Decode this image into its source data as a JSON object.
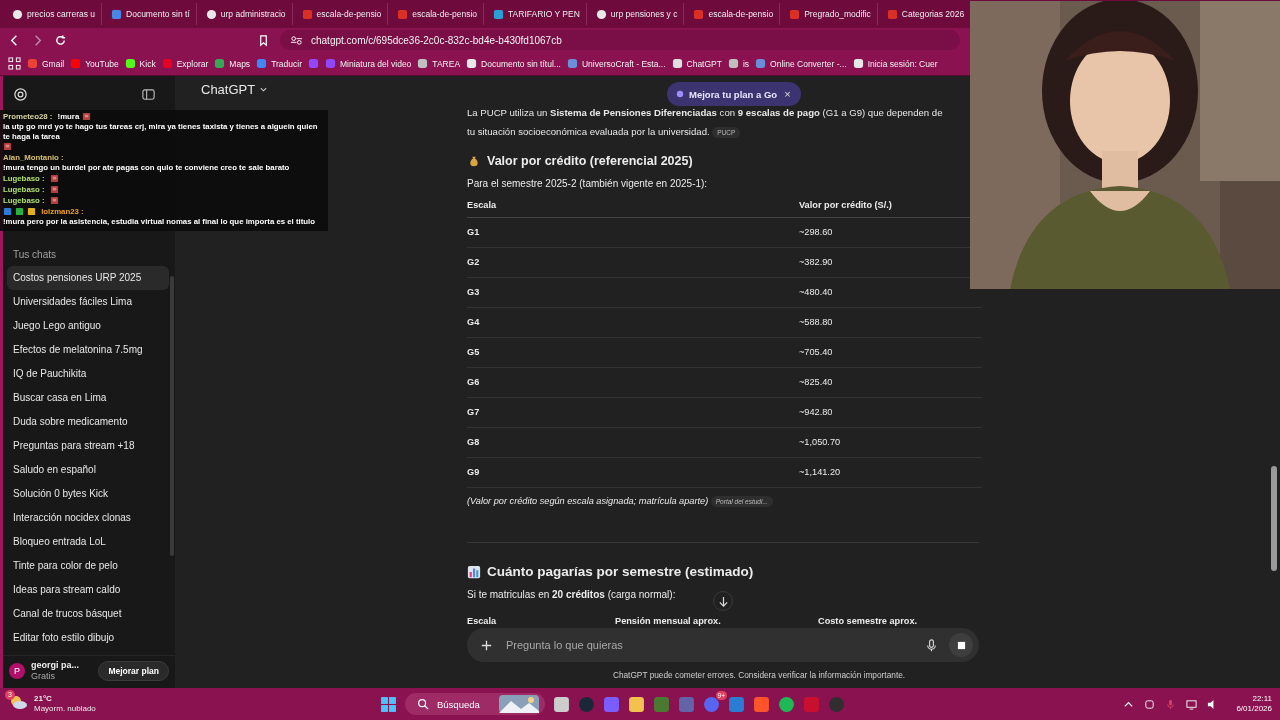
{
  "browser": {
    "tabs": [
      {
        "title": "precios carreras u",
        "kind": "google"
      },
      {
        "title": "Documento sin tí",
        "kind": "doc"
      },
      {
        "title": "urp administracio",
        "kind": "google"
      },
      {
        "title": "escala-de-pensio",
        "kind": "pdf"
      },
      {
        "title": "escala-de-pensio",
        "kind": "pdf"
      },
      {
        "title": "TARIFARIO Y PEN",
        "kind": "letter"
      },
      {
        "title": "urp pensiones y c",
        "kind": "google"
      },
      {
        "title": "escala-de-pensio",
        "kind": "pdf"
      },
      {
        "title": "Pregrado_modific",
        "kind": "pdf"
      },
      {
        "title": "Categorias 2026",
        "kind": "pdf"
      }
    ],
    "url": "chatgpt.com/c/695dce36-2c0c-832c-bd4e-b430fd1067cb",
    "bookmarks": [
      {
        "label": "Gmail",
        "kind": "mail"
      },
      {
        "label": "YouTube",
        "kind": "play"
      },
      {
        "label": "Kick",
        "kind": "kick"
      },
      {
        "label": "Explorar",
        "kind": "pin"
      },
      {
        "label": "Maps",
        "kind": "map"
      },
      {
        "label": "Traducir",
        "kind": "translate"
      },
      {
        "kind": "twitch"
      },
      {
        "label": "Miniatura del video",
        "kind": "twitch"
      },
      {
        "label": "TAREA",
        "kind": "shield"
      },
      {
        "label": "Documento sin títul...",
        "kind": "google"
      },
      {
        "label": "UniversoCraft - Esta...",
        "kind": "globe"
      },
      {
        "label": "ChatGPT",
        "kind": "knot"
      },
      {
        "label": "is",
        "kind": "shield"
      },
      {
        "label": "Online Converter -...",
        "kind": "globe"
      },
      {
        "label": "Inicia sesión: Cuer",
        "kind": "google"
      }
    ]
  },
  "chat_overlay": {
    "messages": [
      {
        "user": "Prometeo28 :",
        "color": "#d8d8a0",
        "segments": [
          {
            "kind": "text",
            "text": "!mura"
          },
          {
            "kind": "emote"
          },
          {
            "kind": "text",
            "text": "la utp go mrd yo te hago tus tareas crj, mira ya tienes taxista y tienes a alguein quien te haga la tarea"
          },
          {
            "kind": "emote"
          }
        ]
      },
      {
        "user": "Alan_Montanio :",
        "color": "#d8c070",
        "segments": [
          {
            "kind": "text",
            "text": "!mura tengo un burdel por ate pagas con qulo te conviene creo te sale barato"
          }
        ]
      },
      {
        "user": "Lugebaso :",
        "color": "#b0e070",
        "segments": [
          {
            "kind": "emote"
          }
        ]
      },
      {
        "user": "Lugebaso :",
        "color": "#b0e070",
        "segments": [
          {
            "kind": "emote"
          }
        ]
      },
      {
        "user": "Lugebaso :",
        "color": "#b0e070",
        "segments": [
          {
            "kind": "emote"
          }
        ]
      },
      {
        "user": "lolzman23 :",
        "color": "#f0a020",
        "segments": [
          {
            "kind": "badge"
          },
          {
            "kind": "badge"
          },
          {
            "kind": "badge"
          },
          {
            "kind": "text",
            "text": "!mura pero por la asistencia, estudia virtual nomas al final lo que importa es el titulo"
          }
        ]
      }
    ]
  },
  "sidebar": {
    "section": "Tus chats",
    "chats": [
      {
        "title": "Costos pensiones URP 2025",
        "selected": true
      },
      {
        "title": "Universidades fáciles Lima",
        "selected": false
      },
      {
        "title": "Juego Lego antiguo",
        "selected": false
      },
      {
        "title": "Efectos de melatonina 7.5mg",
        "selected": false
      },
      {
        "title": "IQ de Pauchikita",
        "selected": false
      },
      {
        "title": "Buscar casa en Lima",
        "selected": false
      },
      {
        "title": "Duda sobre medicamento",
        "selected": false
      },
      {
        "title": "Preguntas para stream +18",
        "selected": false
      },
      {
        "title": "Saludo en español",
        "selected": false
      },
      {
        "title": "Solución 0 bytes Kick",
        "selected": false
      },
      {
        "title": "Interacción nocidex clonas",
        "selected": false
      },
      {
        "title": "Bloqueo entrada LoL",
        "selected": false
      },
      {
        "title": "Tinte para color de pelo",
        "selected": false
      },
      {
        "title": "Ideas para stream caldo",
        "selected": false
      },
      {
        "title": "Canal de trucos básquet",
        "selected": false
      },
      {
        "title": "Editar foto estilo dibujo",
        "selected": false
      }
    ],
    "user": {
      "initial": "P",
      "name": "georgi pa...",
      "plan": "Gratis"
    },
    "upgrade_button": "Mejorar plan"
  },
  "header": {
    "title": "ChatGPT",
    "promo": "Mejora tu plan a Go",
    "promo_close": "×"
  },
  "content": {
    "intro": [
      "La PUCP utiliza un **Sistema de Pensiones Diferenciadas** con **9 escalas de pago** (G1 a G9) que dependen de",
      "tu situación socioeconómica evaluada por la universidad."
    ],
    "intro_source": "PUCP",
    "heading1": "Valor por crédito (referencial 2025)",
    "subtitle1": "Para el semestre 2025-2 (también vigente en 2025-1):",
    "table1": {
      "columns": [
        "Escala",
        "Valor por crédito (S/.)"
      ],
      "rows": [
        [
          "G1",
          "~298.60"
        ],
        [
          "G2",
          "~382.90"
        ],
        [
          "G3",
          "~480.40"
        ],
        [
          "G4",
          "~588.80"
        ],
        [
          "G5",
          "~705.40"
        ],
        [
          "G6",
          "~825.40"
        ],
        [
          "G7",
          "~942.80"
        ],
        [
          "G8",
          "~1,050.70"
        ],
        [
          "G9",
          "~1,141.20"
        ]
      ]
    },
    "note": "(Valor por crédito según escala asignada; matrícula aparte)",
    "note_source": "Portal del estudi...",
    "heading2": "Cuánto pagarías por semestre (estimado)",
    "subtitle2": "Si te matriculas en **20 créditos** (carga normal):",
    "table2": {
      "columns": [
        "Escala",
        "Pensión mensual aprox.",
        "Costo semestre aprox."
      ]
    }
  },
  "composer": {
    "placeholder": "Pregunta lo que quieras",
    "disclaimer": "ChatGPT puede cometer errores. Considera verificar la información importante."
  },
  "taskbar": {
    "weather_badge": "3",
    "temperature": "21°C",
    "condition": "Mayorm. nublado",
    "search": "Búsqueda",
    "apps": [
      {
        "kind": "taskview"
      },
      {
        "kind": "steam"
      },
      {
        "kind": "copilot"
      },
      {
        "kind": "folder"
      },
      {
        "kind": "block"
      },
      {
        "kind": "teams"
      },
      {
        "kind": "discord",
        "badge": "9+"
      },
      {
        "kind": "mail"
      },
      {
        "kind": "brave"
      },
      {
        "kind": "spotify"
      },
      {
        "kind": "red"
      },
      {
        "kind": "obs"
      }
    ],
    "time": "22:11",
    "date": "6/01/2026"
  }
}
